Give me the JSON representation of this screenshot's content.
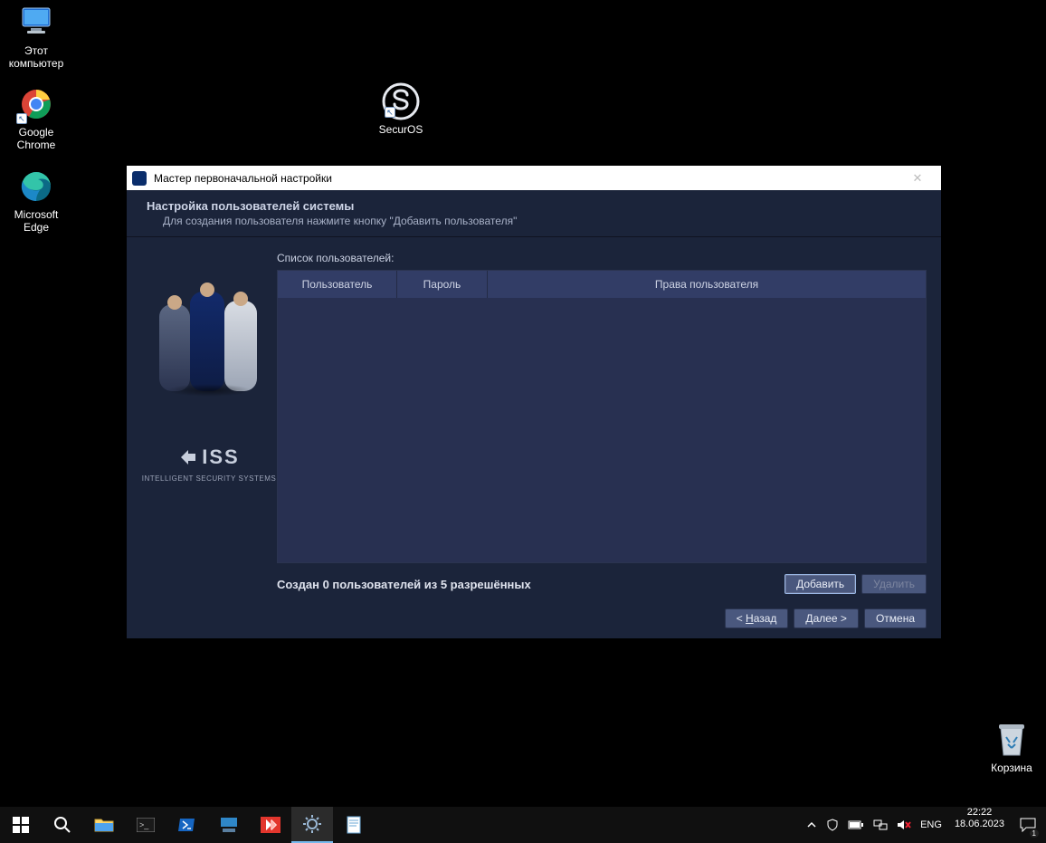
{
  "desktop": {
    "this_pc": "Этот компьютер",
    "chrome": "Google Chrome",
    "edge": "Microsoft Edge",
    "securos": "SecurOS",
    "recycle_bin": "Корзина"
  },
  "wizard": {
    "window_title": "Мастер первоначальной настройки",
    "close_glyph": "✕",
    "heading": "Настройка пользователей системы",
    "subheading": "Для создания пользователя нажмите кнопку \"Добавить пользователя\"",
    "list_label": "Список пользователей:",
    "columns": {
      "user": "Пользователь",
      "password": "Пароль",
      "rights": "Права пользователя"
    },
    "status": "Создан 0 пользователей из 5 разрешённых",
    "add_label": "Добавить",
    "delete_label": "Удалить",
    "back_prefix": "< ",
    "back_ul": "Н",
    "back_suffix": "азад",
    "next_ul": "Д",
    "next_suffix": "алее >",
    "cancel": "Отмена",
    "brand": "ISS",
    "brand_tag": "INTELLIGENT SECURITY SYSTEMS"
  },
  "taskbar": {
    "lang": "ENG",
    "time": "22:22",
    "date": "18.06.2023",
    "notif_count": "1"
  }
}
